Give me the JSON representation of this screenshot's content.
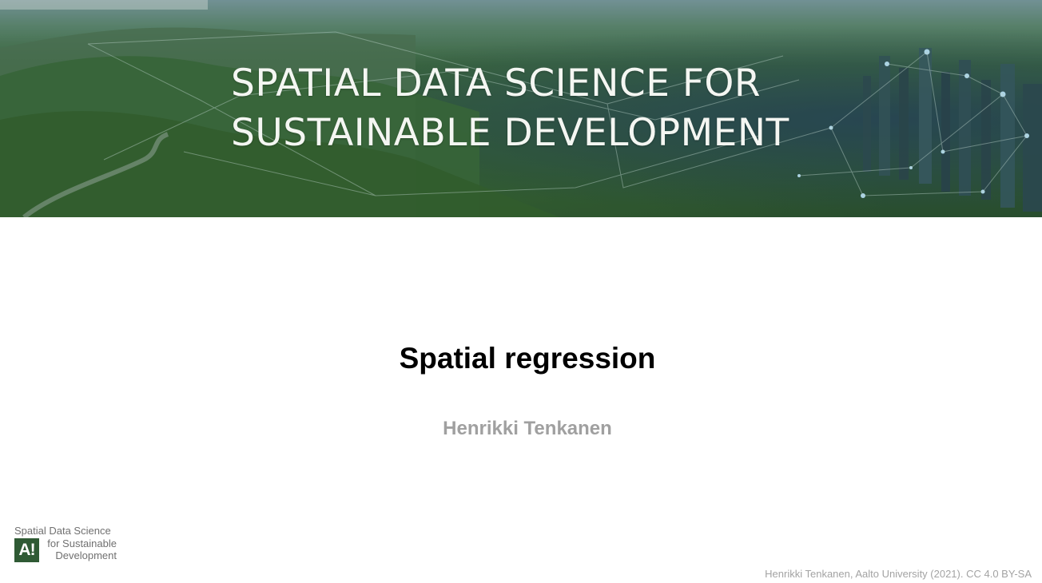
{
  "banner": {
    "title_line1": "SPATIAL DATA SCIENCE FOR",
    "title_line2": "SUSTAINABLE DEVELOPMENT"
  },
  "slide": {
    "title": "Spatial regression",
    "author": "Henrikki Tenkanen"
  },
  "logo": {
    "mark": "A!",
    "line1": "Spatial Data Science",
    "line2": "for Sustainable",
    "line3": "Development"
  },
  "footer": {
    "credit": "Henrikki Tenkanen, Aalto University (2021). CC 4.0 BY-SA"
  },
  "colors": {
    "banner_green": "#335f3d",
    "logo_green": "#2f5a34",
    "title_text": "#000000",
    "author_text": "#a0a0a0",
    "credit_text": "#a3a3a3"
  }
}
